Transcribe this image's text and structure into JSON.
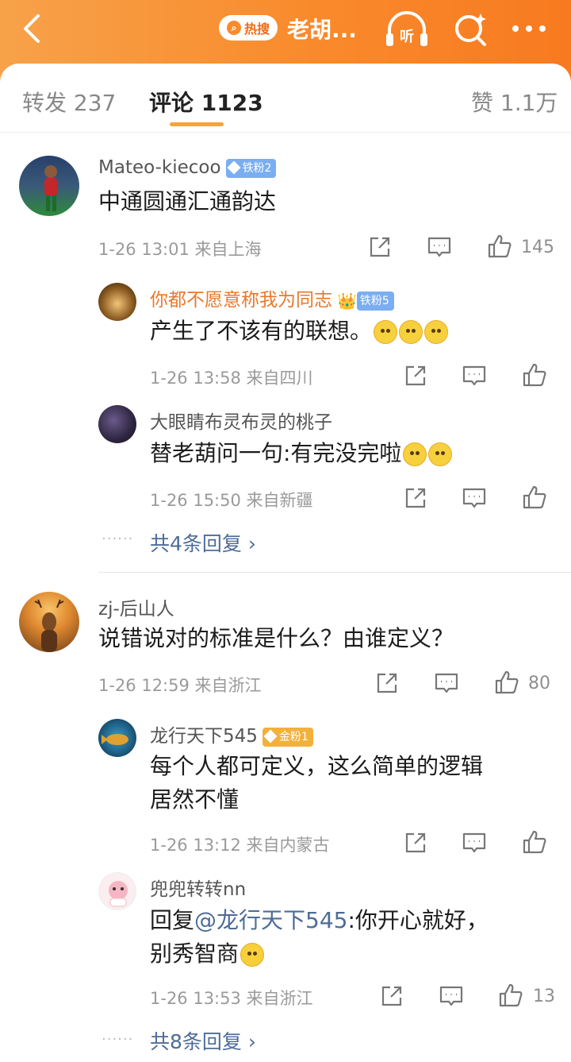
{
  "header": {
    "hot_label": "热搜",
    "title": "老胡...",
    "listen_label": "听"
  },
  "tabs": [
    {
      "label": "转发 237"
    },
    {
      "label": "评论 1123"
    },
    {
      "label": "赞 1.1万"
    }
  ],
  "comments": [
    {
      "user": "Mateo-kiecoo",
      "badge": "铁粉2",
      "text": "中通圆通汇通韵达",
      "meta": "1-26 13:01  来自上海",
      "likes": "145",
      "replies": [
        {
          "user": "你都不愿意称我为同志",
          "badge": "铁粉5",
          "text": "产生了不该有的联想。",
          "meta": "1-26 13:58  来自四川"
        },
        {
          "user": "大眼睛布灵布灵的桃子",
          "text": "替老葫问一句:有完没完啦",
          "meta": "1-26 15:50  来自新疆"
        }
      ],
      "more_replies": "共4条回复"
    },
    {
      "user": "zj-后山人",
      "text": "说错说对的标准是什么？由谁定义？",
      "meta": "1-26 12:59  来自浙江",
      "likes": "80",
      "replies": [
        {
          "user": "龙行天下545",
          "badge": "金粉1",
          "text_line1": "每个人都可定义，这么简单的逻辑",
          "text_line2": "居然不懂",
          "meta": "1-26 13:12  来自内蒙古"
        },
        {
          "user": "兜兜转转nn",
          "text_prefix": "回复",
          "mention": "@龙行天下545",
          "text_rest": ":你开心就好，",
          "text_line2": "别秀智商",
          "meta": "1-26 13:53  来自浙江",
          "likes": "13"
        }
      ],
      "more_replies": "共8条回复"
    }
  ],
  "colors": {
    "header_start": "#f7a24a",
    "header_end": "#f87a1f",
    "accent_tab": "#f6a33c",
    "link": "#4d6c98",
    "vip_name": "#e8782a"
  }
}
